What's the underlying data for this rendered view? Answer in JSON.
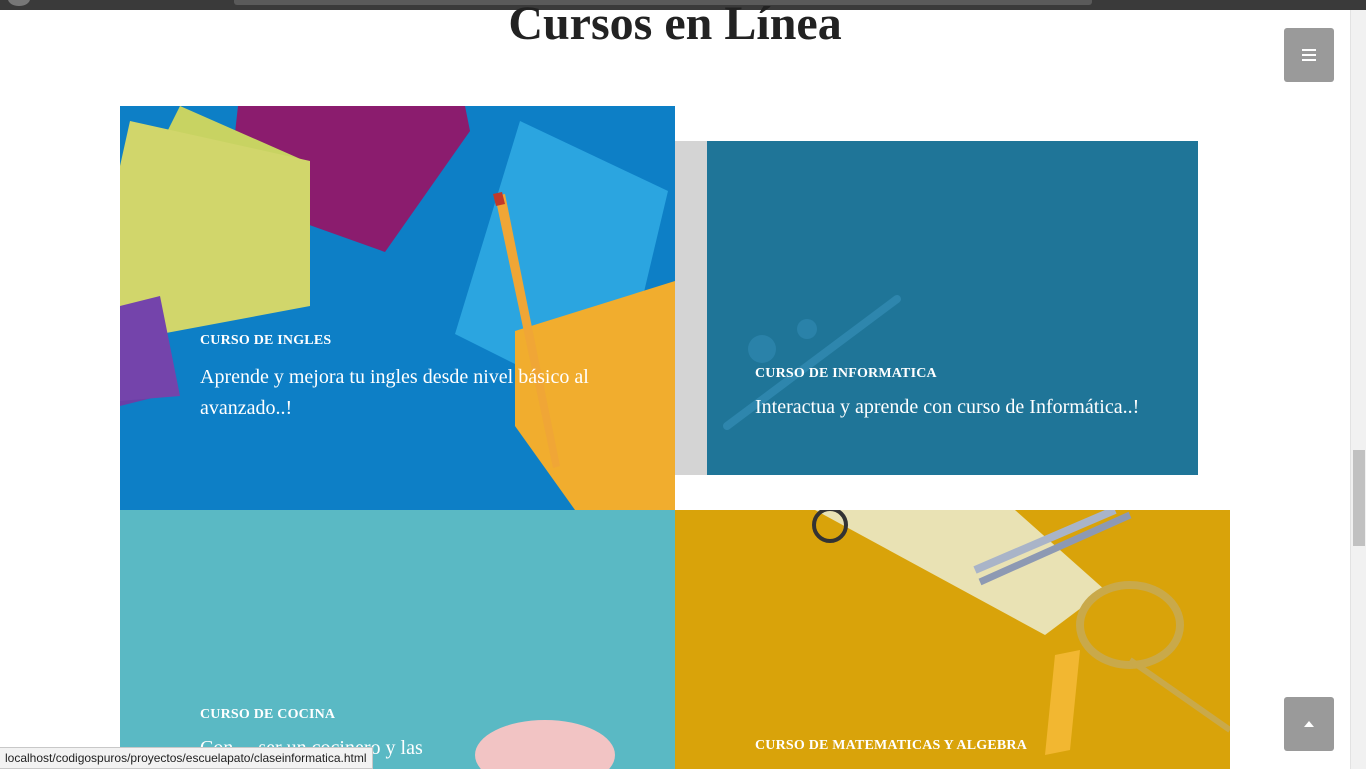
{
  "page": {
    "title": "Cursos en Línea"
  },
  "nav": {
    "menu_icon": "hamburger-icon",
    "top_icon": "chevron-up-icon"
  },
  "courses": [
    {
      "category": "CURSO DE INGLES",
      "description": "Aprende y mejora tu ingles desde nivel básico al avanzado..!",
      "color": "#0d7fc6"
    },
    {
      "category": "CURSO DE INFORMATICA",
      "description": "Interactua y aprende con curso de Informática..!",
      "color": "#1f7598"
    },
    {
      "category": "CURSO DE COCINA",
      "description": "Con ... ser un cocinero y las",
      "color": "#5ab9c4"
    },
    {
      "category": "CURSO DE MATEMATICAS Y ALGEBRA",
      "description": "",
      "color": "#d9a30a"
    }
  ],
  "status_bar": {
    "url": "localhost/codigospuros/proyectos/escuelapato/claseinformatica.html"
  }
}
